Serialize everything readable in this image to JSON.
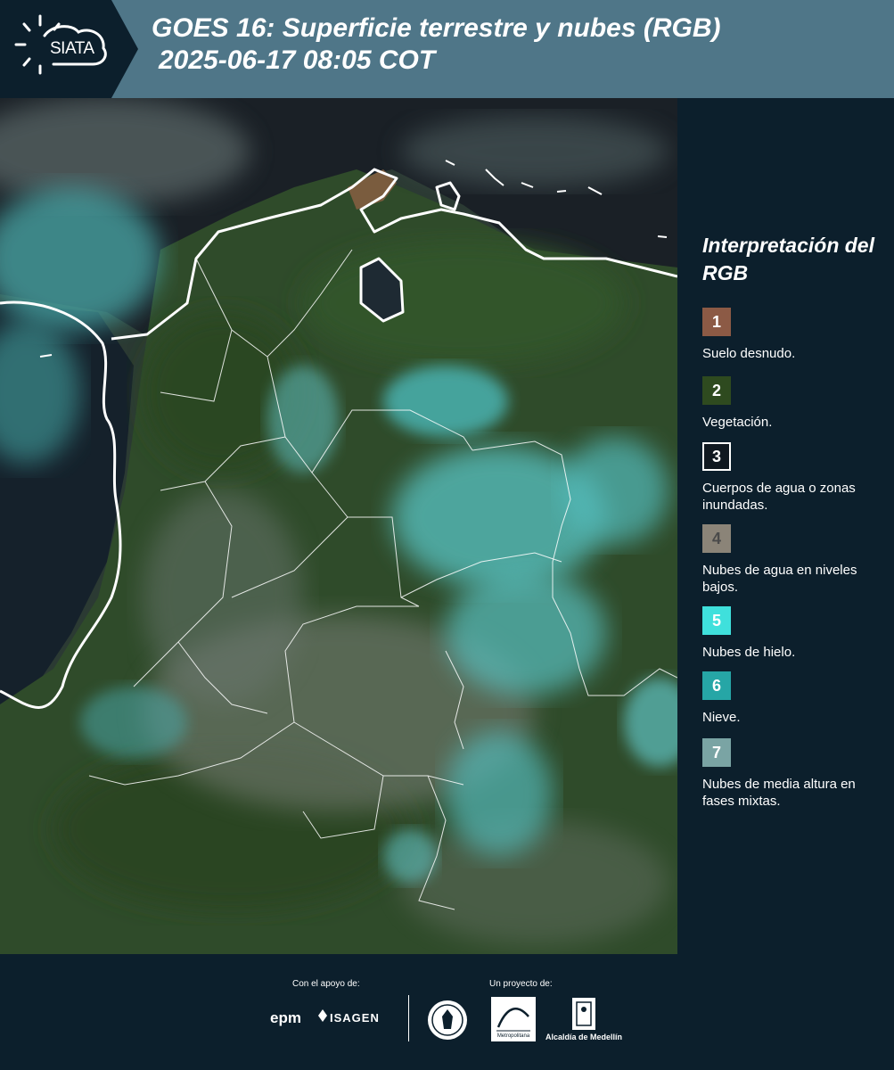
{
  "header": {
    "logo_text": "SIATA",
    "title_line1": "GOES 16: Superficie terrestre y nubes (RGB)",
    "title_line2": "2025-06-17 08:05 COT"
  },
  "legend": {
    "title": "Interpretación del RGB",
    "items": [
      {
        "number": "1",
        "label": "Suelo desnudo.",
        "color": "#8c5a45",
        "text_color": "#ffffff"
      },
      {
        "number": "2",
        "label": "Vegetación.",
        "color": "#2e4a1f",
        "text_color": "#ffffff"
      },
      {
        "number": "3",
        "label": "Cuerpos de agua o zonas inundadas.",
        "color": "#101820",
        "text_color": "#ffffff",
        "border": "#ffffff"
      },
      {
        "number": "4",
        "label": "Nubes de agua en niveles bajos.",
        "color": "#8b8478",
        "text_color": "#4a4a4a"
      },
      {
        "number": "5",
        "label": "Nubes de hielo.",
        "color": "#3fe0dc",
        "text_color": "#ffffff"
      },
      {
        "number": "6",
        "label": "Nieve.",
        "color": "#26a6a6",
        "text_color": "#ffffff"
      },
      {
        "number": "7",
        "label": "Nubes de media altura en fases mixtas.",
        "color": "#7aa4a4",
        "text_color": "#ffffff"
      }
    ]
  },
  "footer": {
    "support_label": "Con el apoyo de:",
    "project_label": "Un proyecto de:",
    "sponsor_1": "epm",
    "sponsor_2": "ISAGEN",
    "partner_1": "Metropolitana",
    "partner_2": "Alcaldía de Medellín"
  }
}
